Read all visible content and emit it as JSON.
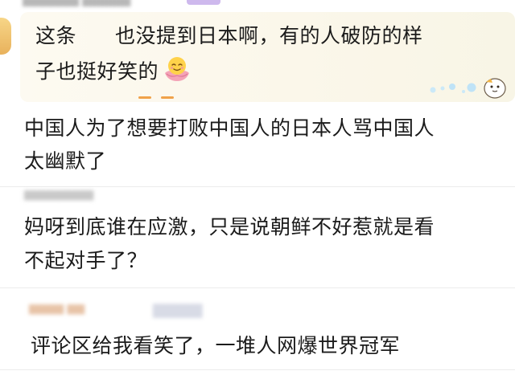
{
  "comments": [
    {
      "text_before": "这条",
      "text_after": "也没提到日本啊，有的人破防的样",
      "line2": "子也挺好笑的",
      "emoji": "smiling-face-in-lotus"
    },
    {
      "line1": "中国人为了想要打败中国人的日本人骂中国人",
      "line2": "太幽默了"
    },
    {
      "line1": "妈呀到底谁在应激，只是说朝鲜不好惹就是看",
      "line2": "不起对手了？"
    },
    {
      "line1": "评论区给我看笑了，一堆人网爆世界冠军"
    }
  ],
  "colors": {
    "text": "#1b1b1b",
    "bubble": "#fbf7ea",
    "accent": "#f0a24a",
    "dots": "#bfe3f7"
  }
}
